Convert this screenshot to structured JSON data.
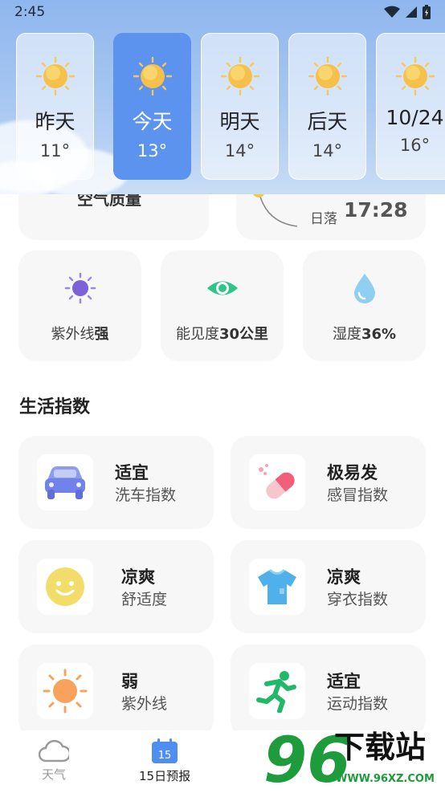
{
  "status": {
    "time": "2:45"
  },
  "days": [
    {
      "label": "昨天",
      "temp": "11°",
      "icon": "sun-icon",
      "active": false
    },
    {
      "label": "今天",
      "temp": "13°",
      "icon": "sun-icon",
      "active": true
    },
    {
      "label": "明天",
      "temp": "14°",
      "icon": "sun-icon",
      "active": false
    },
    {
      "label": "后天",
      "temp": "14°",
      "icon": "sun-icon",
      "active": false
    },
    {
      "label": "10/24",
      "temp": "16°",
      "icon": "sun-icon",
      "active": false
    }
  ],
  "air_quality": {
    "title": "空气质量"
  },
  "sunset": {
    "label": "日落",
    "time": "17:28"
  },
  "metrics": [
    {
      "icon": "uv-sun-icon",
      "label": "紫外线",
      "value": "强"
    },
    {
      "icon": "eye-icon",
      "label": "能见度",
      "value": "30公里"
    },
    {
      "icon": "water-drop-icon",
      "label": "湿度",
      "value": "36%"
    }
  ],
  "life_index": {
    "title": "生活指数",
    "items": [
      {
        "icon": "car-icon",
        "value": "适宜",
        "name": "洗车指数"
      },
      {
        "icon": "pill-icon",
        "value": "极易发",
        "name": "感冒指数"
      },
      {
        "icon": "smiley-icon",
        "value": "凉爽",
        "name": "舒适度"
      },
      {
        "icon": "tshirt-icon",
        "value": "凉爽",
        "name": "穿衣指数"
      },
      {
        "icon": "sun-uv-icon",
        "value": "弱",
        "name": "紫外线"
      },
      {
        "icon": "runner-icon",
        "value": "适宜",
        "name": "运动指数"
      }
    ]
  },
  "tabs": [
    {
      "icon": "cloud-icon",
      "label": "天气",
      "active": false
    },
    {
      "icon": "calendar-icon",
      "label": "15日预报",
      "active": true,
      "badge": "15"
    }
  ],
  "watermark": {
    "number": "96",
    "text": "下载站",
    "url": "WWW.96XZ.COM"
  },
  "colors": {
    "accent": "#5b93ee",
    "card": "#f7f7f7",
    "watermark_green": "#1e9b3a"
  }
}
